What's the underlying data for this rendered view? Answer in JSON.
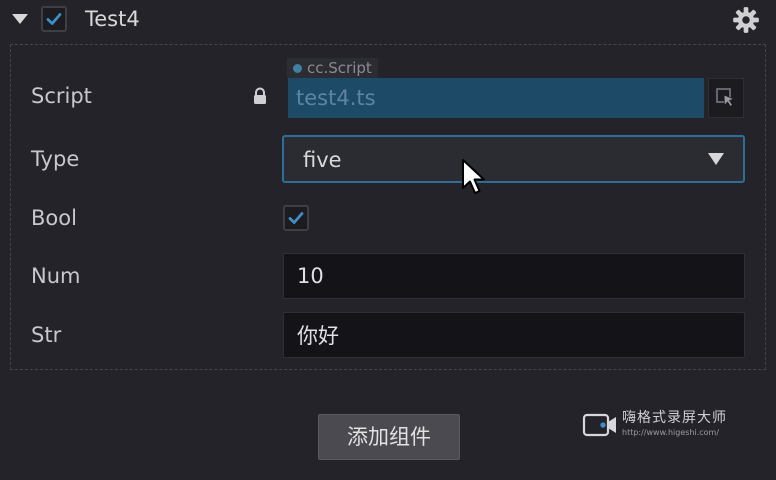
{
  "component": {
    "title": "Test4",
    "enabled": true
  },
  "properties": {
    "script": {
      "label": "Script",
      "type_tag": "cc.Script",
      "value": "test4.ts"
    },
    "type": {
      "label": "Type",
      "selected": "five"
    },
    "bool": {
      "label": "Bool",
      "checked": true
    },
    "num": {
      "label": "Num",
      "value": "10"
    },
    "str": {
      "label": "Str",
      "value": "你好"
    }
  },
  "footer": {
    "add_component_label": "添加组件"
  },
  "watermark": {
    "name": "嗨格式录屏大师",
    "url": "http://www.higeshi.com/"
  },
  "icons": {
    "collapse": "triangle-down-icon",
    "settings": "gear-icon",
    "lock": "lock-icon",
    "locate": "cursor-select-icon",
    "dropdown": "chevron-down-icon"
  },
  "colors": {
    "background": "#232329",
    "accent": "#2e6d96",
    "checkmark": "#3d8fc8",
    "script_field": "#1d4a66"
  }
}
